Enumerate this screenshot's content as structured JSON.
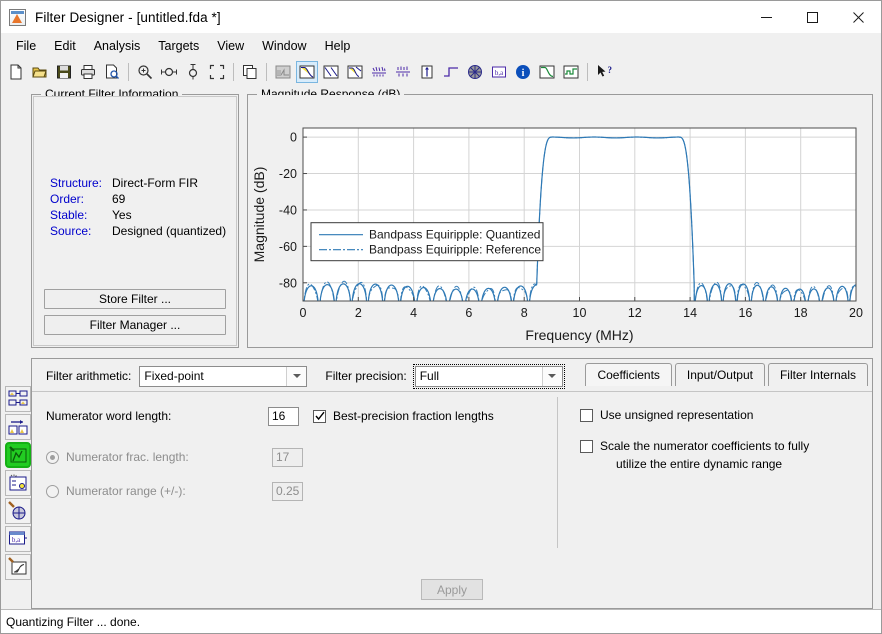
{
  "window": {
    "title": "Filter Designer -   [untitled.fda *]",
    "app_icon": "matlab-filter-icon",
    "minimize_label": "minimize-icon",
    "maximize_label": "maximize-icon",
    "close_label": "close-icon"
  },
  "menu": {
    "items": [
      {
        "label": "File"
      },
      {
        "label": "Edit"
      },
      {
        "label": "Analysis"
      },
      {
        "label": "Targets"
      },
      {
        "label": "View"
      },
      {
        "label": "Window"
      },
      {
        "label": "Help"
      }
    ]
  },
  "toolbar": {
    "buttons": [
      {
        "name": "new-file-icon"
      },
      {
        "name": "open-file-icon"
      },
      {
        "name": "save-file-icon"
      },
      {
        "name": "print-icon"
      },
      {
        "name": "print-preview-icon"
      },
      {
        "name": "zoom-in-icon"
      },
      {
        "name": "zoom-x-icon"
      },
      {
        "name": "zoom-y-icon"
      },
      {
        "name": "restore-view-icon"
      },
      {
        "name": "copy-icon"
      },
      {
        "name": "filter-specifications-icon"
      },
      {
        "name": "magnitude-response-icon"
      },
      {
        "name": "phase-response-icon"
      },
      {
        "name": "magnitude-and-phase-icon"
      },
      {
        "name": "group-delay-icon"
      },
      {
        "name": "phase-delay-icon"
      },
      {
        "name": "impulse-response-icon"
      },
      {
        "name": "step-response-icon"
      },
      {
        "name": "pole-zero-plot-icon"
      },
      {
        "name": "filter-coefficients-icon"
      },
      {
        "name": "filter-information-icon"
      },
      {
        "name": "magnitude-response-estimate-icon"
      },
      {
        "name": "round-off-noise-power-icon"
      },
      {
        "name": "context-help-icon"
      }
    ]
  },
  "sidebar": {
    "items": [
      {
        "name": "sidebar-design-filter",
        "active": false
      },
      {
        "name": "sidebar-import-filter",
        "active": false
      },
      {
        "name": "sidebar-quantization-parameters",
        "active": true
      },
      {
        "name": "sidebar-transform-filter",
        "active": false
      },
      {
        "name": "sidebar-pole-zero-editor",
        "active": false
      },
      {
        "name": "sidebar-set-quantization-parameters",
        "active": false
      },
      {
        "name": "sidebar-realize-model",
        "active": false
      }
    ]
  },
  "current_filter_information": {
    "title": "Current Filter Information",
    "rows": [
      {
        "key": "Structure:",
        "value": "Direct-Form FIR"
      },
      {
        "key": "Order:",
        "value": "69"
      },
      {
        "key": "Stable:",
        "value": "Yes"
      },
      {
        "key": "Source:",
        "value": "Designed (quantized)"
      }
    ],
    "store_filter_label": "Store Filter ...",
    "filter_manager_label": "Filter Manager ..."
  },
  "magnitude_panel": {
    "title": "Magnitude Response (dB)"
  },
  "chart_data": {
    "type": "line",
    "title": "Magnitude Response (dB)",
    "xlabel": "Frequency (MHz)",
    "ylabel": "Magnitude (dB)",
    "xlim": [
      0,
      20
    ],
    "ylim": [
      -90,
      5
    ],
    "xticks": [
      0,
      2,
      4,
      6,
      8,
      10,
      12,
      14,
      16,
      18,
      20
    ],
    "yticks": [
      0,
      -20,
      -40,
      -60,
      -80
    ],
    "grid": true,
    "legend_position": "center-left",
    "legend": [
      {
        "label": "Bandpass Equiripple: Quantized",
        "style": "solid",
        "color": "#2e79b5"
      },
      {
        "label": "Bandpass Equiripple: Reference",
        "style": "dash-dot",
        "color": "#2e79b5"
      }
    ],
    "passband": [
      9.0,
      13.6
    ],
    "stopband_level_db": -82,
    "series": [
      {
        "name": "Bandpass Equiripple: Quantized",
        "style": "solid",
        "color": "#2e79b5",
        "description": "Bandpass FIR magnitude response: lower stopband 0-8.5 MHz equiripple near -82 dB with 14 ripple lobes, transition 8.5-9.2 MHz, flat passband 9.2-13.4 MHz at 0 dB, transition 13.4-14.6 MHz, upper stopband 14.6-20 MHz equiripple near -82 dB with 11 ripple lobes"
      },
      {
        "name": "Bandpass Equiripple: Reference",
        "style": "dash-dot",
        "color": "#2e79b5",
        "description": "Nearly coincident with quantized trace; visible only in stopband ripple minima"
      }
    ]
  },
  "quantization": {
    "filter_arithmetic_label": "Filter arithmetic:",
    "filter_arithmetic_value": "Fixed-point",
    "filter_precision_label": "Filter precision:",
    "filter_precision_value": "Full",
    "tabs": [
      {
        "label": "Coefficients",
        "active": true
      },
      {
        "label": "Input/Output",
        "active": false
      },
      {
        "label": "Filter Internals",
        "active": false
      }
    ],
    "numerator_word_length_label": "Numerator word length:",
    "numerator_word_length_value": "16",
    "best_precision_label": "Best-precision fraction lengths",
    "best_precision_checked": true,
    "numerator_frac_length_label": "Numerator frac. length:",
    "numerator_frac_length_value": "17",
    "numerator_frac_length_selected": true,
    "numerator_range_label": "Numerator range (+/-):",
    "numerator_range_value": "0.25",
    "numerator_range_selected": false,
    "use_unsigned_label": "Use unsigned representation",
    "use_unsigned_checked": false,
    "scale_numerator_label_line1": "Scale the numerator coefficients to fully",
    "scale_numerator_label_line2": "utilize the entire dynamic range",
    "scale_numerator_checked": false,
    "apply_label": "Apply"
  },
  "status": {
    "message": "Quantizing Filter ... done."
  },
  "colors": {
    "plot_line": "#2e79b5",
    "key_text": "#0000cc",
    "selected_rail": "#22cc22",
    "toolbar_selected": "#d8ecfb"
  }
}
